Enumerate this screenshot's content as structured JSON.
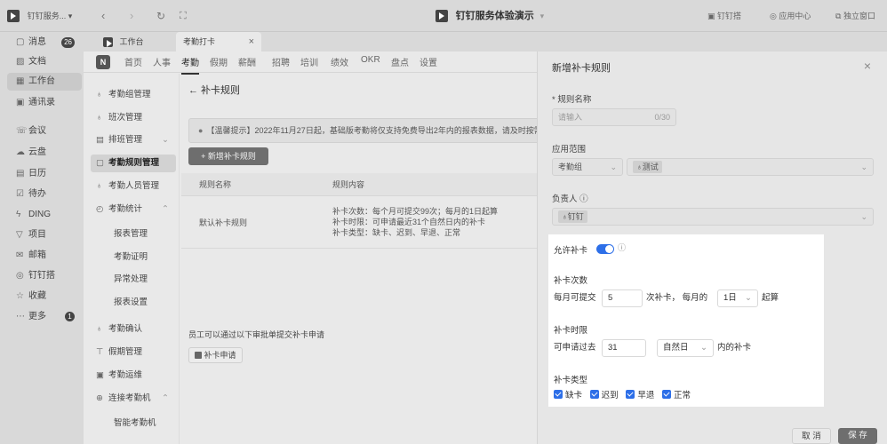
{
  "window": {
    "app_label": "钉钉服务... ▾",
    "title": "钉钉服务体验演示",
    "title_caret": "▾",
    "right_items": [
      "钉钉搭",
      "应用中心",
      "独立窗口"
    ]
  },
  "nav": {
    "back": "‹",
    "forward": "›",
    "refresh": "↻",
    "expand": "⛶"
  },
  "sidebar": {
    "items": [
      {
        "label": "消息",
        "icon": "▢",
        "badge": "26"
      },
      {
        "label": "文档",
        "icon": "▨"
      },
      {
        "label": "工作台",
        "icon": "▦"
      },
      {
        "label": "通讯录",
        "icon": "▣"
      },
      {
        "label": "会议",
        "icon": "☏"
      },
      {
        "label": "云盘",
        "icon": "☁"
      },
      {
        "label": "日历",
        "icon": "▤"
      },
      {
        "label": "待办",
        "icon": "☑"
      },
      {
        "label": "DING",
        "icon": "ϟ"
      },
      {
        "label": "项目",
        "icon": "▽"
      },
      {
        "label": "邮箱",
        "icon": "✉"
      },
      {
        "label": "钉钉搭",
        "icon": "◎"
      },
      {
        "label": "收藏",
        "icon": "☆"
      },
      {
        "label": "更多",
        "icon": "⋯",
        "badge": "1"
      }
    ]
  },
  "tabs": {
    "workbench": "工作台",
    "active": "考勤打卡",
    "close": "×"
  },
  "topnav": {
    "logo": "N",
    "items": [
      "首页",
      "人事",
      "考勤",
      "假期",
      "薪酬",
      "招聘",
      "培训",
      "绩效",
      "OKR",
      "盘点",
      "设置"
    ]
  },
  "subnav": {
    "items": [
      {
        "label": "考勤组管理",
        "icon": "♁"
      },
      {
        "label": "班次管理",
        "icon": "♁"
      },
      {
        "label": "排班管理",
        "icon": "▤",
        "caret": "⌄"
      },
      {
        "label": "考勤规则管理",
        "icon": "▢"
      },
      {
        "label": "考勤人员管理",
        "icon": "♁"
      },
      {
        "label": "考勤统计",
        "icon": "◴",
        "caret": "⌃"
      },
      {
        "label": "报表管理"
      },
      {
        "label": "考勤证明"
      },
      {
        "label": "异常处理"
      },
      {
        "label": "报表设置"
      },
      {
        "label": "考勤确认",
        "icon": "♁"
      },
      {
        "label": "假期管理",
        "icon": "⊤"
      },
      {
        "label": "考勤运维",
        "icon": "▣"
      },
      {
        "label": "连接考勤机",
        "icon": "⊕",
        "caret": "⌃"
      },
      {
        "label": "智能考勤机"
      }
    ]
  },
  "content": {
    "back_title": "← 补卡规则",
    "notice": "【温馨提示】2022年11月27日起，基础版考勤将仅支持免费导出2年内的报表数据，请及时按需",
    "notice_icon": "●",
    "add_button": "+  新增补卡规则",
    "columns": [
      "规则名称",
      "规则内容"
    ],
    "rows": [
      {
        "name": "默认补卡规则",
        "content": [
          "补卡次数：每个月可提交99次；每月的1日起算",
          "补卡时限：可申请最近31个自然日内的补卡",
          "补卡类型：缺卡、迟到、早退、正常"
        ]
      }
    ],
    "approval_text": "员工可以通过以下审批单提交补卡申请",
    "approval_button": "补卡申请"
  },
  "panel": {
    "title": "新增补卡规则",
    "close": "×",
    "name_label": "* 规则名称",
    "name_placeholder": "请输入",
    "name_counter": "0/30",
    "scope_label": "应用范围",
    "scope_type": "考勤组",
    "scope_value": "测试",
    "owner_label": "负责人 ⓘ",
    "owner_value": "钉钉",
    "allow_label": "允许补卡",
    "allow_on": true,
    "count_label": "补卡次数",
    "count_prefix": "每月可提交",
    "count_value": "5",
    "count_mid": "次补卡，  每月的",
    "count_day": "1日",
    "count_suffix": "起算",
    "limit_label": "补卡时限",
    "limit_prefix": "可申请过去",
    "limit_value": "31",
    "limit_unit": "自然日",
    "limit_suffix": "内的补卡",
    "type_label": "补卡类型",
    "types": [
      "缺卡",
      "迟到",
      "早退",
      "正常"
    ],
    "cancel": "取 消",
    "save": "保 存",
    "caret": "⌄"
  }
}
